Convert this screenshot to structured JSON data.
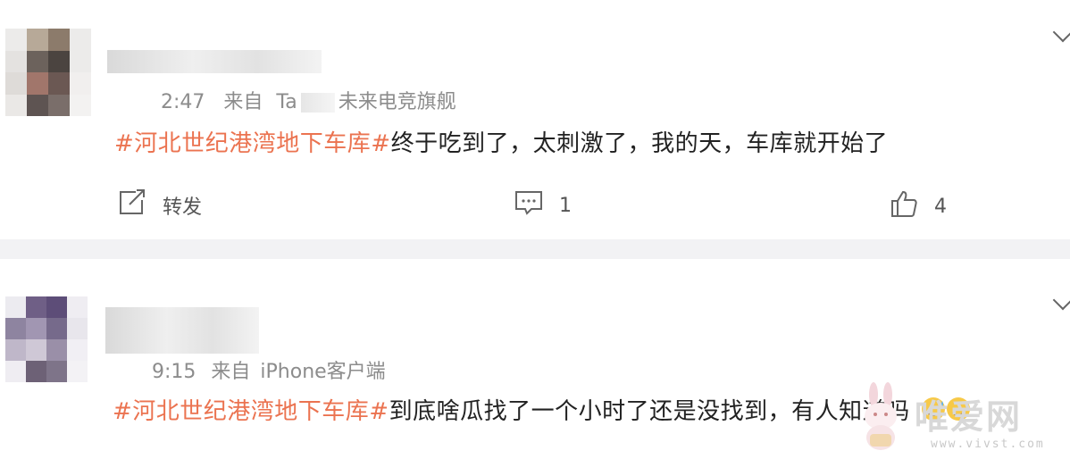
{
  "comments": [
    {
      "meta_prefix": "2:47",
      "meta_from": "来自",
      "meta_device_part": "Ta",
      "meta_device_suffix": "未来电竞旗舰",
      "hashtag": "#河北世纪港湾地下车库#",
      "text": "终于吃到了，太刺激了，我的天，车库就开始了",
      "actions": {
        "repost_label": "转发",
        "comment_count": "1",
        "like_count": "4"
      }
    },
    {
      "meta_prefix": "9:15",
      "meta_from": "来自",
      "meta_device": "iPhone客户端",
      "hashtag": "#河北世纪港湾地下车库#",
      "text": "到底啥瓜找了一个小时了还是没找到，有人知道吗"
    }
  ],
  "watermark": {
    "text": "唯爱网",
    "url": "www.vivst.com"
  },
  "icons": {
    "repost": "repost-icon",
    "comment": "comment-icon",
    "like": "like-icon",
    "expand": "chevron-down-icon",
    "emoji": "sweat-smile-emoji"
  },
  "colors": {
    "hashtag": "#eb7350",
    "meta": "#8c8c8c",
    "divider": "#f2f2f4"
  }
}
